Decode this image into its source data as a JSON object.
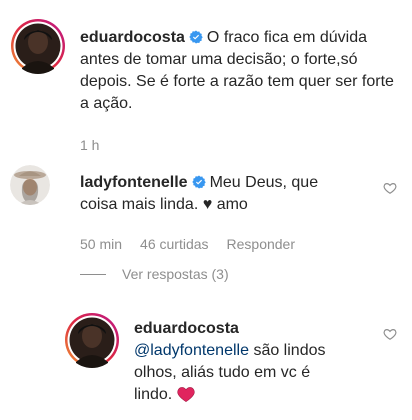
{
  "comments": [
    {
      "username": "eduardocosta",
      "text": "O fraco fica em dúvida antes de tomar uma decisão; o forte,só depois. Se é forte a razão tem quer ser forte a ação.",
      "time": "1 h"
    },
    {
      "username": "ladyfontenelle",
      "text_line1": "Meu Deus, que",
      "text_line2": "coisa mais linda.",
      "text_heart": "♥",
      "text_end": "amo",
      "time": "50 min",
      "likes": "46 curtidas",
      "reply_label": "Responder",
      "view_replies": "Ver respostas (3)"
    },
    {
      "username": "eduardocosta",
      "mention": "@ladyfontenelle",
      "text_after_mention": "são lindos",
      "text_line2": "olhos, aliás tudo em vc é",
      "text_line3": "lindo.",
      "emoji": "red-heart"
    }
  ],
  "icons": {
    "verified": "verified-badge-icon",
    "like": "heart-outline-icon",
    "emoji_heart": "red-heart-emoji"
  },
  "colors": {
    "verified_blue": "#3897f0",
    "mention": "#00376b",
    "muted": "#8e8e8e",
    "story_ring_start": "#f09433",
    "story_ring_end": "#bc1888",
    "emoji_red": "#e0245e"
  }
}
